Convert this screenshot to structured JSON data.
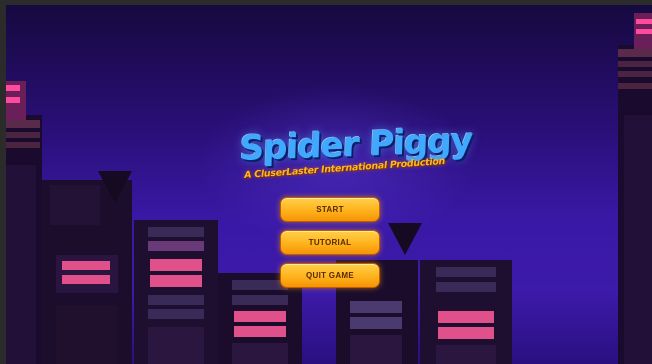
{
  "game": {
    "title": "Spider Piggy",
    "subtitle": "A CluserLaster International Production"
  },
  "menu": {
    "start_label": "START",
    "tutorial_label": "TUTORIAL",
    "quit_label": "QUIT GAME"
  },
  "colors": {
    "sky_top": "#16093f",
    "sky_mid": "#3a18a6",
    "title_blue": "#3fa8ff",
    "subtitle_orange": "#ffb820",
    "button_yellow": "#ffb21c",
    "window_pink": "#e0508a"
  }
}
